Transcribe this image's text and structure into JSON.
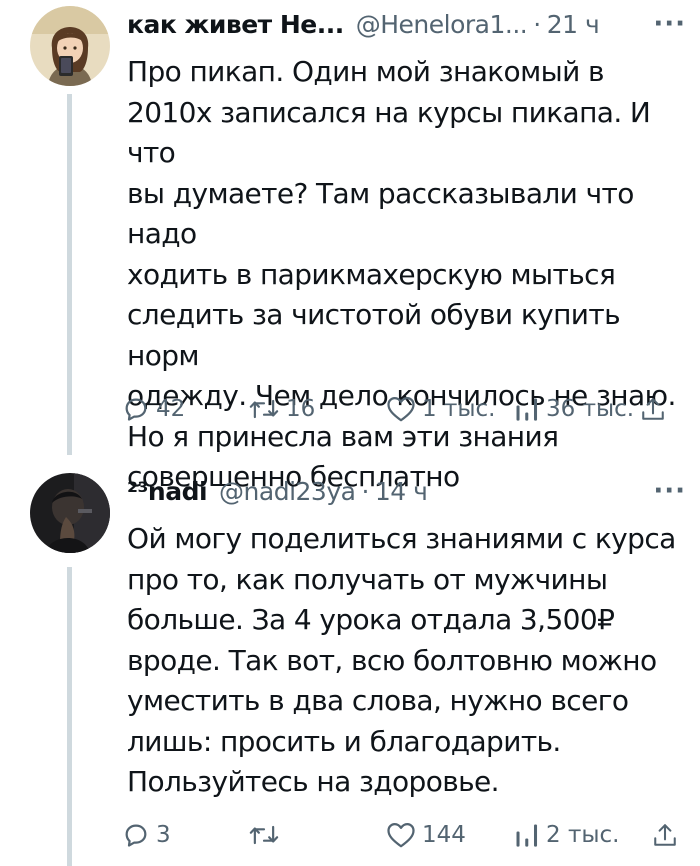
{
  "tweets": [
    {
      "name": "как живет Не...",
      "handle": "@Henelora1...",
      "separator": "·",
      "time": "21 ч",
      "more": "···",
      "lines": [
        "Про пикап. Один мой знакомый в",
        "2010х записался на курсы пикапа. И что",
        "вы думаете? Там рассказывали что надо",
        "ходить в парикмахерскую мыться",
        "следить за чистотой обуви купить норм",
        "одежду. Чем дело кончилось не знаю.",
        "Но я принесла вам эти знания",
        "совершенно бесплатно"
      ],
      "replies": "42",
      "retweets": "16",
      "likes": "1 тыс.",
      "views": "36 тыс."
    },
    {
      "name": "²³nadi",
      "handle": "@nadi23ya",
      "separator": "·",
      "time": "14 ч",
      "more": "···",
      "lines": [
        "Ой могу поделиться знаниями с курса",
        "про то, как получать от мужчины",
        "больше. За 4 урока отдала 3,500₽",
        "вроде. Так вот, всю болтовню можно",
        "уместить в два слова, нужно всего",
        "лишь: просить и благодарить.",
        "Пользуйтесь на здоровье."
      ],
      "replies": "3",
      "retweets": "",
      "likes": "144",
      "views": "2 тыс."
    }
  ],
  "icons": {
    "reply": "reply-icon",
    "retweet": "retweet-icon",
    "like": "heart-icon",
    "views": "views-icon",
    "share": "share-icon"
  },
  "colors": {
    "text": "#0f1419",
    "secondary": "#536471",
    "thread_line": "#cfd9de"
  }
}
